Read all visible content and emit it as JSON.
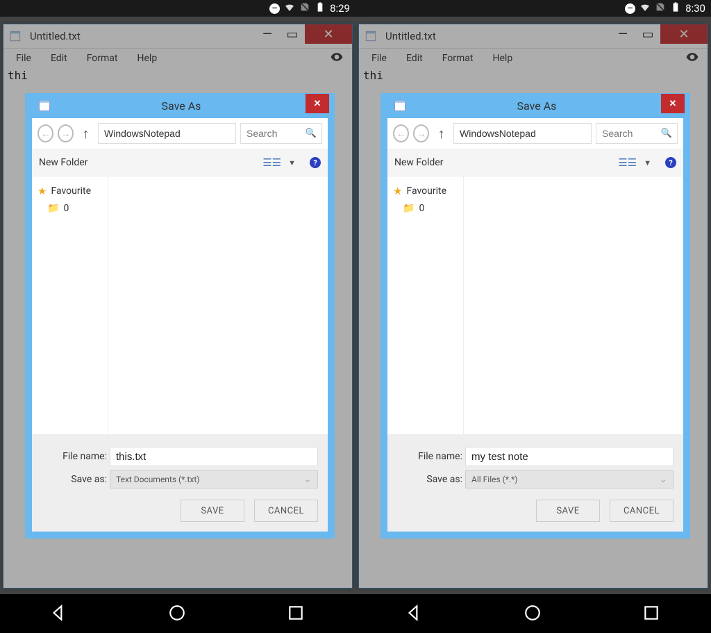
{
  "screens": [
    {
      "statusbar": {
        "time": "8:29"
      },
      "notepad": {
        "title": "Untitled.txt",
        "menus": {
          "file": "File",
          "edit": "Edit",
          "format": "Format",
          "help": "Help"
        },
        "content": "thi"
      },
      "saveas": {
        "title": "Save As",
        "path": "WindowsNotepad",
        "search_placeholder": "Search",
        "newfolder_label": "New Folder",
        "tree": {
          "favourite": "Favourite",
          "folder0": "0"
        },
        "filename_label": "File name:",
        "filename_value": "this.txt",
        "saveas_label": "Save as:",
        "saveas_value": "Text Documents (*.txt)",
        "save_btn": "SAVE",
        "cancel_btn": "CANCEL"
      }
    },
    {
      "statusbar": {
        "time": "8:30"
      },
      "notepad": {
        "title": "Untitled.txt",
        "menus": {
          "file": "File",
          "edit": "Edit",
          "format": "Format",
          "help": "Help"
        },
        "content": "thi"
      },
      "saveas": {
        "title": "Save As",
        "path": "WindowsNotepad",
        "search_placeholder": "Search",
        "newfolder_label": "New Folder",
        "tree": {
          "favourite": "Favourite",
          "folder0": "0"
        },
        "filename_label": "File name:",
        "filename_value": "my test note",
        "saveas_label": "Save as:",
        "saveas_value": "All Files (*.*)",
        "save_btn": "SAVE",
        "cancel_btn": "CANCEL"
      }
    }
  ]
}
